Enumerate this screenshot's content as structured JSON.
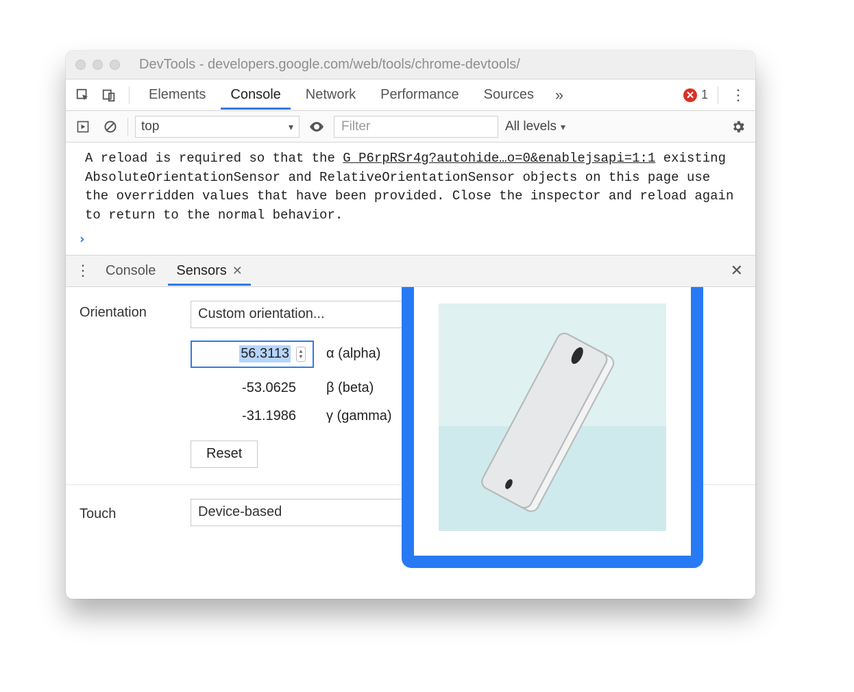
{
  "window": {
    "title": "DevTools - developers.google.com/web/tools/chrome-devtools/"
  },
  "tabs": {
    "items": [
      "Elements",
      "Console",
      "Network",
      "Performance",
      "Sources"
    ],
    "active": "Console",
    "overflow_glyph": "»",
    "error_count": "1"
  },
  "consoleToolbar": {
    "context": "top",
    "filter_placeholder": "Filter",
    "levels_label": "All levels"
  },
  "consoleMessage": {
    "pre": "A reload is required so that the ",
    "link": "G P6rpRSr4g?autohide…o=0&enablejsapi=1:1",
    "rest": "existing AbsoluteOrientationSensor and RelativeOrientationSensor objects on this page use the overridden values that have been provided. Close the inspector and reload again to return to the normal behavior."
  },
  "console_prompt": "›",
  "drawer": {
    "tabs": [
      "Console",
      "Sensors"
    ],
    "active": "Sensors"
  },
  "orientation": {
    "label": "Orientation",
    "preset": "Custom orientation...",
    "alpha": {
      "value": "56.3113",
      "label": "α (alpha)"
    },
    "beta": {
      "value": "-53.0625",
      "label": "β (beta)"
    },
    "gamma": {
      "value": "-31.1986",
      "label": "γ (gamma)"
    },
    "reset_label": "Reset"
  },
  "touch": {
    "label": "Touch",
    "value": "Device-based"
  }
}
